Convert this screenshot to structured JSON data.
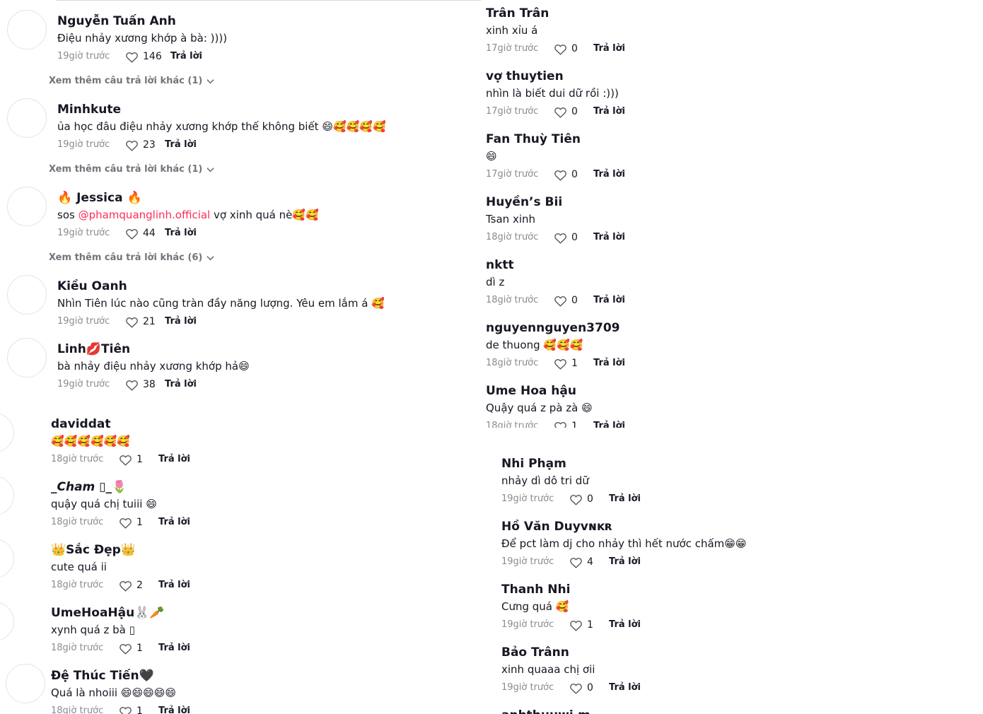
{
  "reply_label": "Trả lời",
  "panel_a": {
    "comments": [
      {
        "name": "Nguyễn Tuấn Anh",
        "text": "Điệu nhảy xương khớp à bà: ))))",
        "time": "19giờ trước",
        "likes": "146",
        "more": "Xem thêm câu trả lời khác (1)"
      },
      {
        "name": "Minhkute",
        "text": "ủa học đâu điệu nhảy xương khớp thế không biết 😄🥰🥰🥰🥰",
        "time": "19giờ trước",
        "likes": "23",
        "more": "Xem thêm câu trả lời khác (1)"
      },
      {
        "name": "🔥 Jessica 🔥",
        "text_before": "sos ",
        "mention": "@phamquanglinh.official",
        "text_after": " vợ xinh quá nè🥰🥰",
        "time": "19giờ trước",
        "likes": "44",
        "more": "Xem thêm câu trả lời khác (6)"
      },
      {
        "name": "Kiều Oanh",
        "text": "Nhìn Tiên lúc nào cũng tràn đầy năng lượng. Yêu em lắm á 🥰",
        "time": "19giờ trước",
        "likes": "21"
      },
      {
        "name": "Linh💋Tiên",
        "text": "bà nhảy điệu nhảy xương khớp hả😄",
        "time": "19giờ trước",
        "likes": "38"
      }
    ]
  },
  "panel_b": {
    "comments": [
      {
        "name": "Trân Trân",
        "text": "xinh xỉu á",
        "time": "17giờ trước",
        "likes": "0"
      },
      {
        "name": "vợ thuytien",
        "text": "nhìn là biết dui dữ rồi :)))",
        "time": "17giờ trước",
        "likes": "0"
      },
      {
        "name": "Fan Thuỳ Tiên",
        "text": "😄",
        "time": "17giờ trước",
        "likes": "0"
      },
      {
        "name": "Huyền’s Bii",
        "text": "Tsan xinh",
        "time": "18giờ trước",
        "likes": "0"
      },
      {
        "name": "nktt",
        "text": "dì z",
        "time": "18giờ trước",
        "likes": "0"
      },
      {
        "name": "nguyennguyen3709",
        "text": "de thuong 🥰🥰🥰",
        "time": "18giờ trước",
        "likes": "1"
      },
      {
        "name": "Ume Hoa hậu",
        "text": "Quậy quá z pà zà 😄",
        "time": "18giờ trước",
        "likes": "1"
      }
    ]
  },
  "panel_c": {
    "comments": [
      {
        "name": "daviddat",
        "text": "🥰🥰🥰🥰🥰🥰",
        "time": "18giờ trước",
        "likes": "1"
      },
      {
        "name": "_𝘾𝙝𝙖𝙢 ▯_🌷",
        "text": "quậy quá chị tuiii 😄",
        "time": "18giờ trước",
        "likes": "1"
      },
      {
        "name": "👑Sắc Đẹp👑",
        "text": "cute quá ii",
        "time": "18giờ trước",
        "likes": "2"
      },
      {
        "name": "UmeHoaHậu🐰🥕",
        "text": "xynh quá z bà ▯",
        "time": "18giờ trước",
        "likes": "1"
      },
      {
        "name": "Đệ Thúc Tiến🖤",
        "text": "Quá là nhoiii 😄😄😄😄😄",
        "time": "18giờ trước",
        "likes": "1"
      }
    ]
  },
  "panel_d": {
    "comments": [
      {
        "name": "Nhi Phạm",
        "text": "nhảy dì dô tri dữ",
        "time": "19giờ trước",
        "likes": "0"
      },
      {
        "name": "Hồ Văn Duyᴠɴᴋʀ",
        "text": "Để pct làm dj cho nhảy thì hết nước chấm😁😁",
        "time": "19giờ trước",
        "likes": "4"
      },
      {
        "name": "Thanh Nhi",
        "text": "Cưng quá 🥰",
        "time": "19giờ trước",
        "likes": "1"
      },
      {
        "name": "Bảo Trânn",
        "text": "xinh quaaa chị ơii",
        "time": "19giờ trước",
        "likes": "0"
      },
      {
        "name": "anhthuuwi.m",
        "text": "",
        "time": "",
        "likes": ""
      }
    ]
  }
}
